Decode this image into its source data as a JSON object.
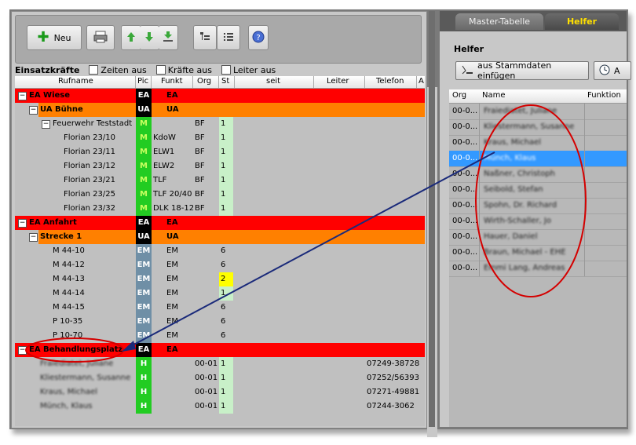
{
  "toolbar": {
    "new_label": "Neu",
    "icons": [
      "print-icon",
      "arrow-up-icon",
      "arrow-down-icon",
      "import-icon",
      "tree-icon",
      "list-icon",
      "help-icon"
    ]
  },
  "filters": {
    "title": "Einsatzkräfte",
    "zeiten": "Zeiten aus",
    "kraefte": "Kräfte aus",
    "leiter": "Leiter aus"
  },
  "columns": {
    "rufname": "Rufname",
    "pic": "Pic",
    "funkt": "Funkt",
    "org": "Org",
    "st": "St",
    "seit": "seit",
    "leiter": "Leiter",
    "telefon": "Telefon",
    "a": "A"
  },
  "rows": [
    {
      "name": "EA Wiese",
      "pic": "EA",
      "funkt": "EA",
      "org": "",
      "st": "",
      "tel": "",
      "style": "ea",
      "indent": 0,
      "tree": "−"
    },
    {
      "name": "UA Bühne",
      "pic": "UA",
      "funkt": "UA",
      "org": "",
      "st": "",
      "tel": "",
      "style": "ua",
      "indent": 1,
      "tree": "−"
    },
    {
      "name": "Feuerwehr Teststadt",
      "pic": "M",
      "funkt": "",
      "org": "BF",
      "st": "1",
      "tel": "",
      "style": "group",
      "indent": 2,
      "tree": "−"
    },
    {
      "name": "Florian 23/10",
      "pic": "M",
      "funkt": "KdoW",
      "org": "BF",
      "st": "1",
      "tel": "",
      "style": "m",
      "indent": 3,
      "tree": ""
    },
    {
      "name": "Florian 23/11",
      "pic": "M",
      "funkt": "ELW1",
      "org": "BF",
      "st": "1",
      "tel": "",
      "style": "m",
      "indent": 3,
      "tree": ""
    },
    {
      "name": "Florian 23/12",
      "pic": "M",
      "funkt": "ELW2",
      "org": "BF",
      "st": "1",
      "tel": "",
      "style": "m",
      "indent": 3,
      "tree": ""
    },
    {
      "name": "Florian 23/21",
      "pic": "M",
      "funkt": "TLF",
      "org": "BF",
      "st": "1",
      "tel": "",
      "style": "m",
      "indent": 3,
      "tree": ""
    },
    {
      "name": "Florian 23/25",
      "pic": "M",
      "funkt": "TLF 20/40",
      "org": "BF",
      "st": "1",
      "tel": "",
      "style": "m",
      "indent": 3,
      "tree": ""
    },
    {
      "name": "Florian 23/32",
      "pic": "M",
      "funkt": "DLK 18-12",
      "org": "BF",
      "st": "1",
      "tel": "",
      "style": "m",
      "indent": 3,
      "tree": ""
    },
    {
      "name": "EA Anfahrt",
      "pic": "EA",
      "funkt": "EA",
      "org": "",
      "st": "",
      "tel": "",
      "style": "ea",
      "indent": 0,
      "tree": "−"
    },
    {
      "name": "Strecke 1",
      "pic": "UA",
      "funkt": "UA",
      "org": "",
      "st": "",
      "tel": "",
      "style": "ua",
      "indent": 1,
      "tree": "−"
    },
    {
      "name": "M 44-10",
      "pic": "EM",
      "funkt": "EM",
      "org": "",
      "st": "6",
      "tel": "",
      "style": "em",
      "indent": 2,
      "tree": ""
    },
    {
      "name": "M 44-12",
      "pic": "EM",
      "funkt": "EM",
      "org": "",
      "st": "6",
      "tel": "",
      "style": "em",
      "indent": 2,
      "tree": ""
    },
    {
      "name": "M 44-13",
      "pic": "EM",
      "funkt": "EM",
      "org": "",
      "st": "2",
      "tel": "",
      "style": "em",
      "indent": 2,
      "tree": "",
      "st_color": "yellow"
    },
    {
      "name": "M 44-14",
      "pic": "EM",
      "funkt": "EM",
      "org": "",
      "st": "1",
      "tel": "",
      "style": "em",
      "indent": 2,
      "tree": "",
      "st_color": "lightgreen"
    },
    {
      "name": "M 44-15",
      "pic": "EM",
      "funkt": "EM",
      "org": "",
      "st": "6",
      "tel": "",
      "style": "em",
      "indent": 2,
      "tree": ""
    },
    {
      "name": "P 10-35",
      "pic": "EM",
      "funkt": "EM",
      "org": "",
      "st": "6",
      "tel": "",
      "style": "em",
      "indent": 2,
      "tree": ""
    },
    {
      "name": "P 10-70",
      "pic": "EM",
      "funkt": "EM",
      "org": "",
      "st": "6",
      "tel": "",
      "style": "em",
      "indent": 2,
      "tree": ""
    },
    {
      "name": "EA Behandlungsplatz",
      "pic": "EA",
      "funkt": "EA",
      "org": "",
      "st": "",
      "tel": "",
      "style": "ea",
      "indent": 0,
      "tree": "−"
    },
    {
      "name": "Fraiediatet, Juliane",
      "pic": "H",
      "funkt": "",
      "org": "00-01",
      "st": "1",
      "tel": "07249-38728",
      "style": "h",
      "indent": 1,
      "tree": ""
    },
    {
      "name": "Kliestermann, Susanne",
      "pic": "H",
      "funkt": "",
      "org": "00-01",
      "st": "1",
      "tel": "07252/56393",
      "style": "h",
      "indent": 1,
      "tree": ""
    },
    {
      "name": "Kraus, Michael",
      "pic": "H",
      "funkt": "",
      "org": "00-01",
      "st": "1",
      "tel": "07271-49881",
      "style": "h",
      "indent": 1,
      "tree": ""
    },
    {
      "name": "Münch, Klaus",
      "pic": "H",
      "funkt": "",
      "org": "00-01",
      "st": "1",
      "tel": "07244-3062",
      "style": "h",
      "indent": 1,
      "tree": ""
    }
  ],
  "right": {
    "tab_master": "Master-Tabelle",
    "tab_helfer": "Helfer",
    "title": "Helfer",
    "btn_insert": "aus Stammdaten einfügen",
    "btn_second": "A",
    "col_org": "Org",
    "col_name": "Name",
    "col_funktion": "Funktion",
    "rows": [
      {
        "org": "00-0...",
        "name": "Fraiediatet, Juliane"
      },
      {
        "org": "00-0...",
        "name": "Kliestermann, Susanne"
      },
      {
        "org": "00-0...",
        "name": "Kraus, Michael"
      },
      {
        "org": "00-0...",
        "name": "Münch, Klaus",
        "selected": true
      },
      {
        "org": "00-0...",
        "name": "Naßner, Christoph"
      },
      {
        "org": "00-0...",
        "name": "Seibold, Stefan"
      },
      {
        "org": "00-0...",
        "name": "Spohn, Dr. Richard"
      },
      {
        "org": "00-0...",
        "name": "Wirth-Schaller, Jo"
      },
      {
        "org": "00-0...",
        "name": "Hauer, Daniel"
      },
      {
        "org": "00-0...",
        "name": "Braun, Michael - EHE"
      },
      {
        "org": "00-0...",
        "name": "Emmi Lang, Andreas"
      }
    ]
  },
  "colors": {
    "ea_red": "#ff0000",
    "ua_orange": "#ff8000",
    "pic_green": "#22cc22",
    "pic_em": "#6f8fa6",
    "pic_ea": "#000000",
    "selection_blue": "#3399ff",
    "annotation_red": "#d40000",
    "arrow_navy": "#1a2a7a"
  }
}
